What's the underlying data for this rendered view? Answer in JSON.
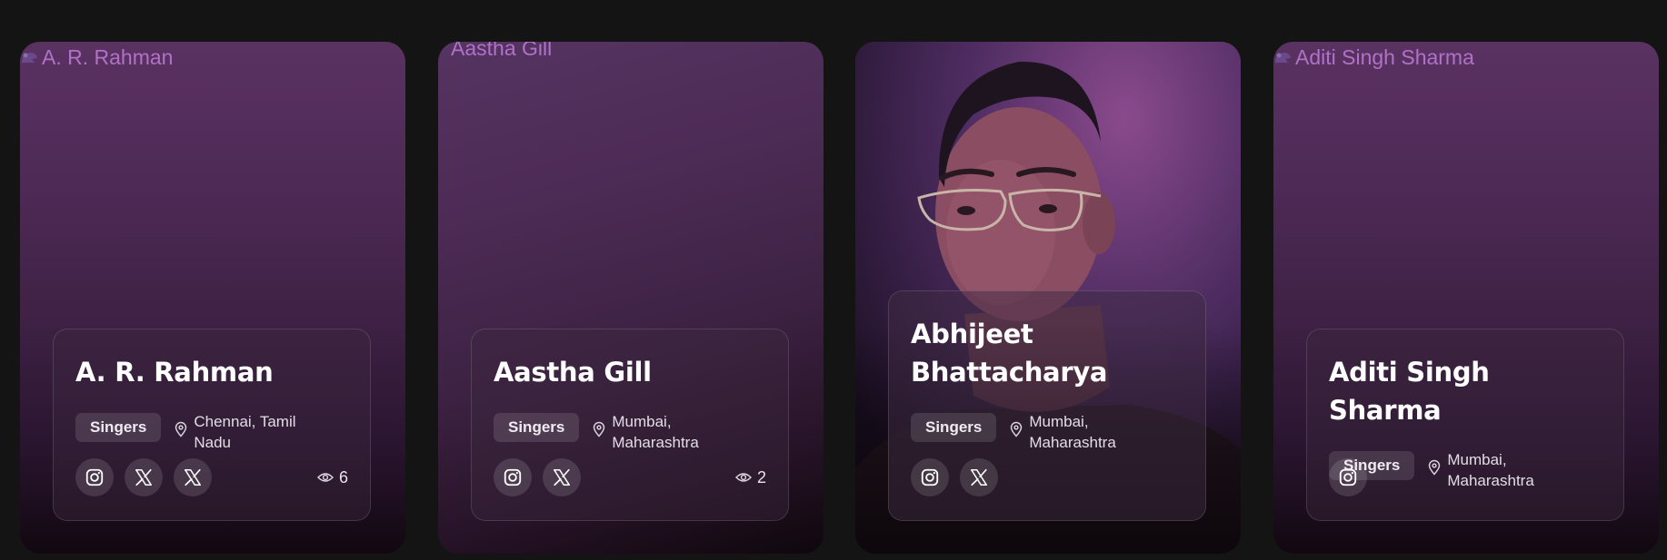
{
  "cards": [
    {
      "alt_text": "A. R. Rahman",
      "name": "A. R. Rahman",
      "category": "Singers",
      "location": "Chennai, Tamil Nadu",
      "socials": [
        "instagram-icon",
        "x-icon",
        "x-icon"
      ],
      "views": "6"
    },
    {
      "alt_text": "Aastha Gill",
      "name": "Aastha Gill",
      "category": "Singers",
      "location": "Mumbai, Maharashtra",
      "socials": [
        "instagram-icon",
        "x-icon"
      ],
      "views": "2"
    },
    {
      "name": "Abhijeet Bhattacharya",
      "category": "Singers",
      "location": "Mumbai, Maharashtra",
      "socials": [
        "instagram-icon",
        "x-icon"
      ]
    },
    {
      "alt_text": "Aditi Singh Sharma",
      "name": "Aditi Singh Sharma",
      "category": "Singers",
      "location": "Mumbai, Maharashtra",
      "socials": [
        "instagram-icon"
      ]
    }
  ],
  "colors": {
    "page_background": "#141414",
    "alt_text": "#b071c7",
    "card_top": "#5a3262",
    "card_bottom": "#120810"
  }
}
